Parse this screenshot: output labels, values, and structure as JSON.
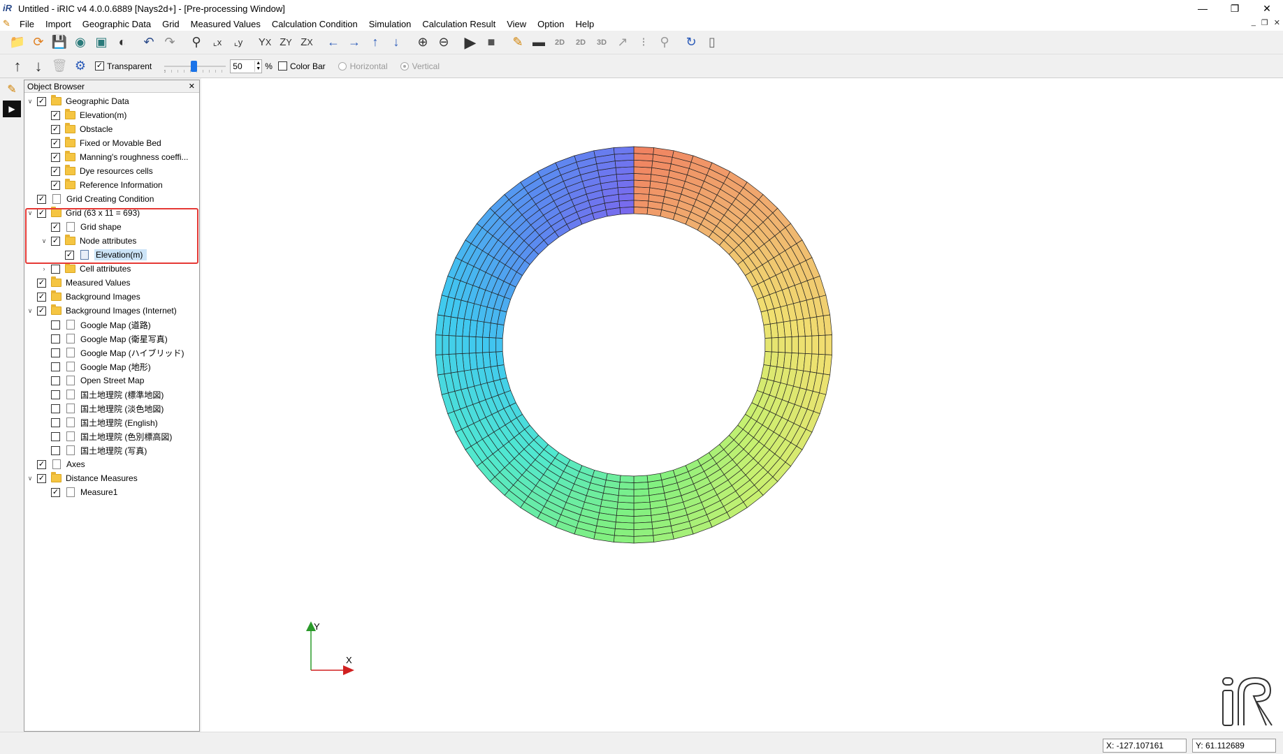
{
  "window": {
    "title": "Untitled - iRIC v4 4.0.0.6889 [Nays2d+] - [Pre-processing Window]",
    "controls": [
      "—",
      "❐",
      "✕"
    ]
  },
  "menubar": {
    "items": [
      "File",
      "Import",
      "Geographic Data",
      "Grid",
      "Measured Values",
      "Calculation Condition",
      "Simulation",
      "Calculation Result",
      "View",
      "Option",
      "Help"
    ],
    "mdi_controls": [
      "_",
      "❐",
      "✕"
    ]
  },
  "toolbar2": {
    "transparent_label": "Transparent",
    "transparent_checked": true,
    "opacity_value": "50",
    "opacity_unit": "%",
    "colorbar_label": "Color Bar",
    "horizontal_label": "Horizontal",
    "vertical_label": "Vertical"
  },
  "object_browser": {
    "title": "Object Browser",
    "close": "✕",
    "items": [
      {
        "label": "Geographic Data",
        "level": 0,
        "exp": "v",
        "checked": true,
        "icon": "folder"
      },
      {
        "label": "Elevation(m)",
        "level": 1,
        "checked": true,
        "icon": "folder"
      },
      {
        "label": "Obstacle",
        "level": 1,
        "checked": true,
        "icon": "folder"
      },
      {
        "label": "Fixed or Movable Bed",
        "level": 1,
        "checked": true,
        "icon": "folder"
      },
      {
        "label": "Manning's roughness coeffi...",
        "level": 1,
        "checked": true,
        "icon": "folder"
      },
      {
        "label": "Dye resources cells",
        "level": 1,
        "checked": true,
        "icon": "folder"
      },
      {
        "label": "Reference Information",
        "level": 1,
        "checked": true,
        "icon": "folder"
      },
      {
        "label": "Grid Creating Condition",
        "level": 0,
        "checked": true,
        "icon": "doc"
      },
      {
        "label": "Grid (63 x 11 = 693)",
        "level": 0,
        "exp": "v",
        "checked": true,
        "icon": "folder"
      },
      {
        "label": "Grid shape",
        "level": 1,
        "checked": true,
        "icon": "doc"
      },
      {
        "label": "Node attributes",
        "level": 1,
        "exp": "v",
        "checked": true,
        "icon": "folder"
      },
      {
        "label": "Elevation(m)",
        "level": 2,
        "checked": true,
        "icon": "doc-blue",
        "selected": true
      },
      {
        "label": "Cell attributes",
        "level": 1,
        "exp": ">",
        "checked": false,
        "icon": "folder"
      },
      {
        "label": "Measured Values",
        "level": 0,
        "checked": true,
        "icon": "folder"
      },
      {
        "label": "Background Images",
        "level": 0,
        "checked": true,
        "icon": "folder"
      },
      {
        "label": "Background Images (Internet)",
        "level": 0,
        "exp": "v",
        "checked": true,
        "icon": "folder"
      },
      {
        "label": "Google Map (道路)",
        "level": 1,
        "checked": false,
        "icon": "doc"
      },
      {
        "label": "Google Map (衛星写真)",
        "level": 1,
        "checked": false,
        "icon": "doc"
      },
      {
        "label": "Google Map (ハイブリッド)",
        "level": 1,
        "checked": false,
        "icon": "doc"
      },
      {
        "label": "Google Map (地形)",
        "level": 1,
        "checked": false,
        "icon": "doc"
      },
      {
        "label": "Open Street Map",
        "level": 1,
        "checked": false,
        "icon": "doc"
      },
      {
        "label": "国土地理院 (標準地図)",
        "level": 1,
        "checked": false,
        "icon": "doc"
      },
      {
        "label": "国土地理院 (淡色地図)",
        "level": 1,
        "checked": false,
        "icon": "doc"
      },
      {
        "label": "国土地理院 (English)",
        "level": 1,
        "checked": false,
        "icon": "doc"
      },
      {
        "label": "国土地理院 (色別標高図)",
        "level": 1,
        "checked": false,
        "icon": "doc"
      },
      {
        "label": "国土地理院 (写真)",
        "level": 1,
        "checked": false,
        "icon": "doc"
      },
      {
        "label": "Axes",
        "level": 0,
        "checked": true,
        "icon": "doc"
      },
      {
        "label": "Distance Measures",
        "level": 0,
        "exp": "v",
        "checked": true,
        "icon": "folder"
      },
      {
        "label": "Measure1",
        "level": 1,
        "checked": true,
        "icon": "doc"
      }
    ]
  },
  "grid": {
    "i_nodes": 63,
    "j_nodes": 11,
    "colors": [
      "#7b68ee",
      "#5a8cf0",
      "#40c8f0",
      "#50e8d0",
      "#80f080",
      "#c8f070",
      "#f0e070",
      "#f0b070",
      "#f08060"
    ]
  },
  "axes": {
    "x_label": "X",
    "y_label": "Y"
  },
  "statusbar": {
    "x": "X: -127.107161",
    "y": "Y: 61.112689"
  }
}
